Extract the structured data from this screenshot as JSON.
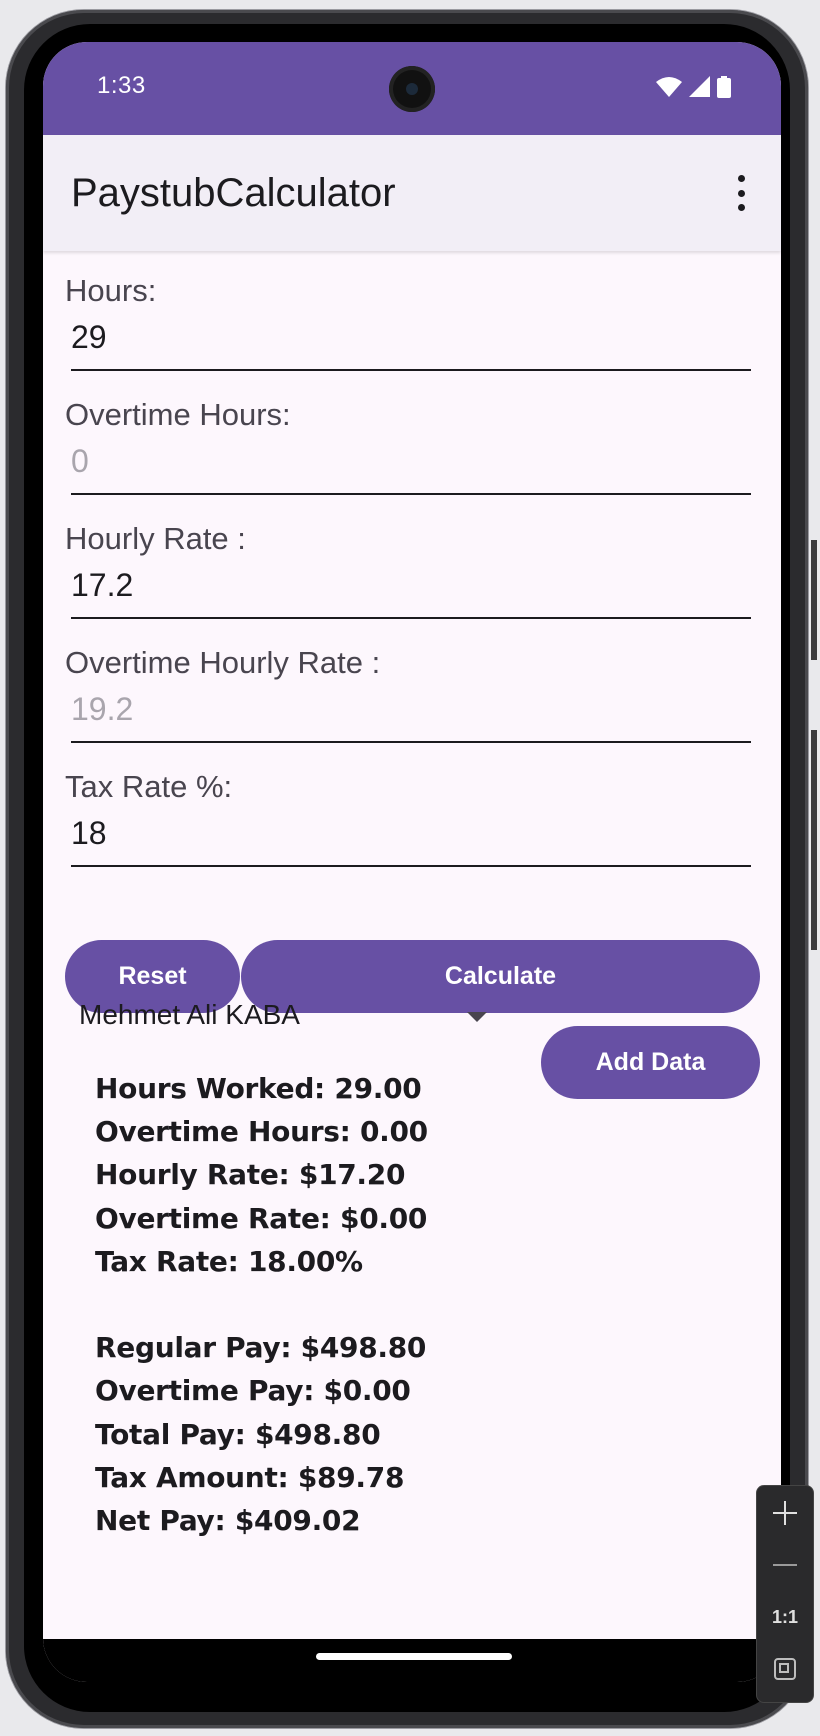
{
  "status_bar": {
    "time": "1:33"
  },
  "app_bar": {
    "title": "PaystubCalculator",
    "overflow_icon": "more-vert-icon"
  },
  "form": {
    "hours": {
      "label": "Hours:",
      "value": "29",
      "placeholder": ""
    },
    "overtime_hours": {
      "label": "Overtime Hours:",
      "value": "",
      "placeholder": "0"
    },
    "hourly_rate": {
      "label": "Hourly Rate :",
      "value": "17.2",
      "placeholder": ""
    },
    "overtime_hourly_rate": {
      "label": "Overtime Hourly Rate :",
      "value": "",
      "placeholder": "19.2"
    },
    "tax_rate": {
      "label": "Tax Rate %:",
      "value": "18",
      "placeholder": ""
    }
  },
  "buttons": {
    "reset": "Reset",
    "calculate": "Calculate",
    "add_data": "Add Data"
  },
  "spinner": {
    "selected": "Mehmet Ali KABA"
  },
  "results": {
    "hours_worked": "Hours Worked: 29.00",
    "overtime_hours": "Overtime Hours: 0.00",
    "hourly_rate": "Hourly Rate: $17.20",
    "overtime_rate": "Overtime Rate: $0.00",
    "tax_rate": "Tax Rate: 18.00%",
    "regular_pay": "Regular Pay: $498.80",
    "overtime_pay": "Overtime Pay: $0.00",
    "total_pay": "Total Pay: $498.80",
    "tax_amount": "Tax Amount: $89.78",
    "net_pay": "Net Pay: $409.02"
  },
  "emulator_zoom": {
    "one_to_one": "1:1"
  },
  "colors": {
    "primary": "#6750a4",
    "surface": "#fdf7fd",
    "app_bar": "#f2eef6"
  }
}
